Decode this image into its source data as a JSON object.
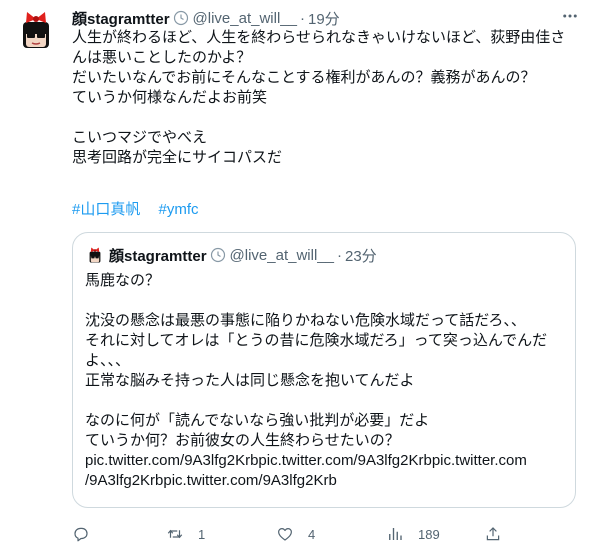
{
  "author": {
    "name": "顔stagramtter",
    "handle": "@live_at_will__",
    "separator": "·",
    "time": "19分"
  },
  "tweet": {
    "lines": [
      "人生が終わるほど、人生を終わらせられなきゃいけないほど、荻野由佳さ",
      "んは悪いことしたのかよ？",
      "だいたいなんでお前にそんなことする権利があんの？義務があんの？",
      "ていうか何様なんだよお前笑",
      "",
      "こいつマジでやべえ",
      "思考回路が完全にサイコパスだ"
    ],
    "hashtags": [
      "#山口真帆",
      "#ymfc"
    ]
  },
  "quoted": {
    "name": "顔stagramtter",
    "handle": "@live_at_will__",
    "separator": "·",
    "time": "23分",
    "lines": [
      "馬鹿なの？",
      "",
      "沈没の懸念は最悪の事態に陥りかねない危険水域だって話だろ、、",
      "それに対してオレは「とうの昔に危険水域だろ」って突っ込んでんだ",
      "よ、、、",
      "正常な脳みそ持った人は同じ懸念を抱いてんだよ",
      "",
      "なのに何が「読んでないなら強い批判が必要」だよ",
      "ていうか何？お前彼女の人生終わらせたいの？",
      "pic.twitter.com/9A3lfg2Krbpic.twitter.com/9A3lfg2Krbpic.twitter.com",
      "/9A3lfg2Krbpic.twitter.com/9A3lfg2Krb"
    ]
  },
  "actions": {
    "reply_icon": "reply-icon",
    "reply_count": "",
    "retweet_icon": "retweet-icon",
    "retweet_count": "1",
    "like_icon": "heart-icon",
    "like_count": "4",
    "views_icon": "views-icon",
    "views_count": "189",
    "share_icon": "share-icon"
  },
  "colors": {
    "text": "#0f1419",
    "secondary": "#536471",
    "link": "#1d9bf0",
    "border": "#cfd9de"
  }
}
